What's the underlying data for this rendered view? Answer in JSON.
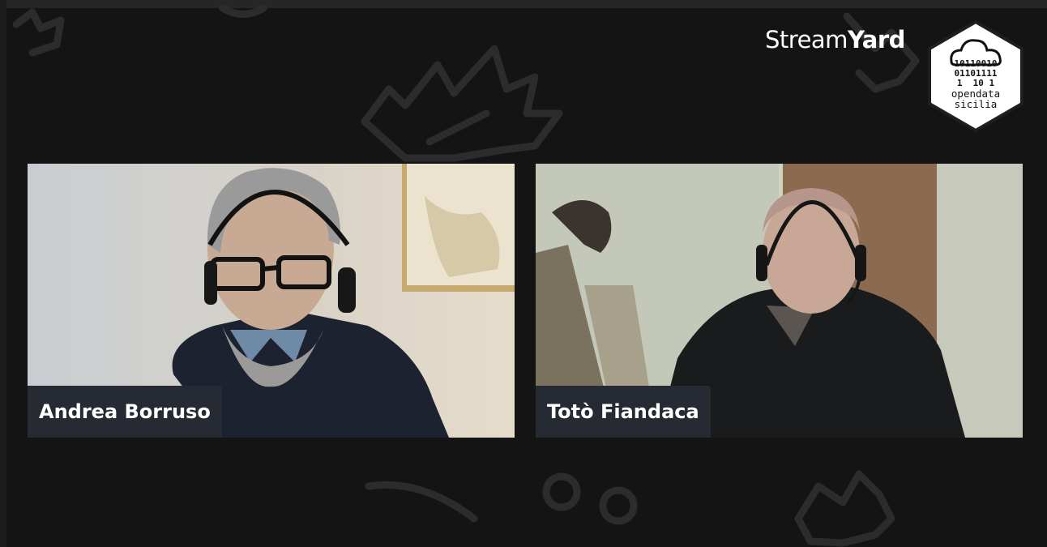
{
  "brand": {
    "part1": "Stream",
    "part2": "Yard"
  },
  "logo": {
    "bits": [
      "10110010",
      "01101111",
      "1  10 1"
    ],
    "line1": "opendata",
    "line2": "sicilia"
  },
  "participants": [
    {
      "name": "Andrea Borruso"
    },
    {
      "name": "Totò Fiandaca"
    }
  ],
  "colors": {
    "background": "#141414",
    "nametag": "#262a33",
    "deco": "#2c2c2c",
    "text": "#ffffff"
  }
}
